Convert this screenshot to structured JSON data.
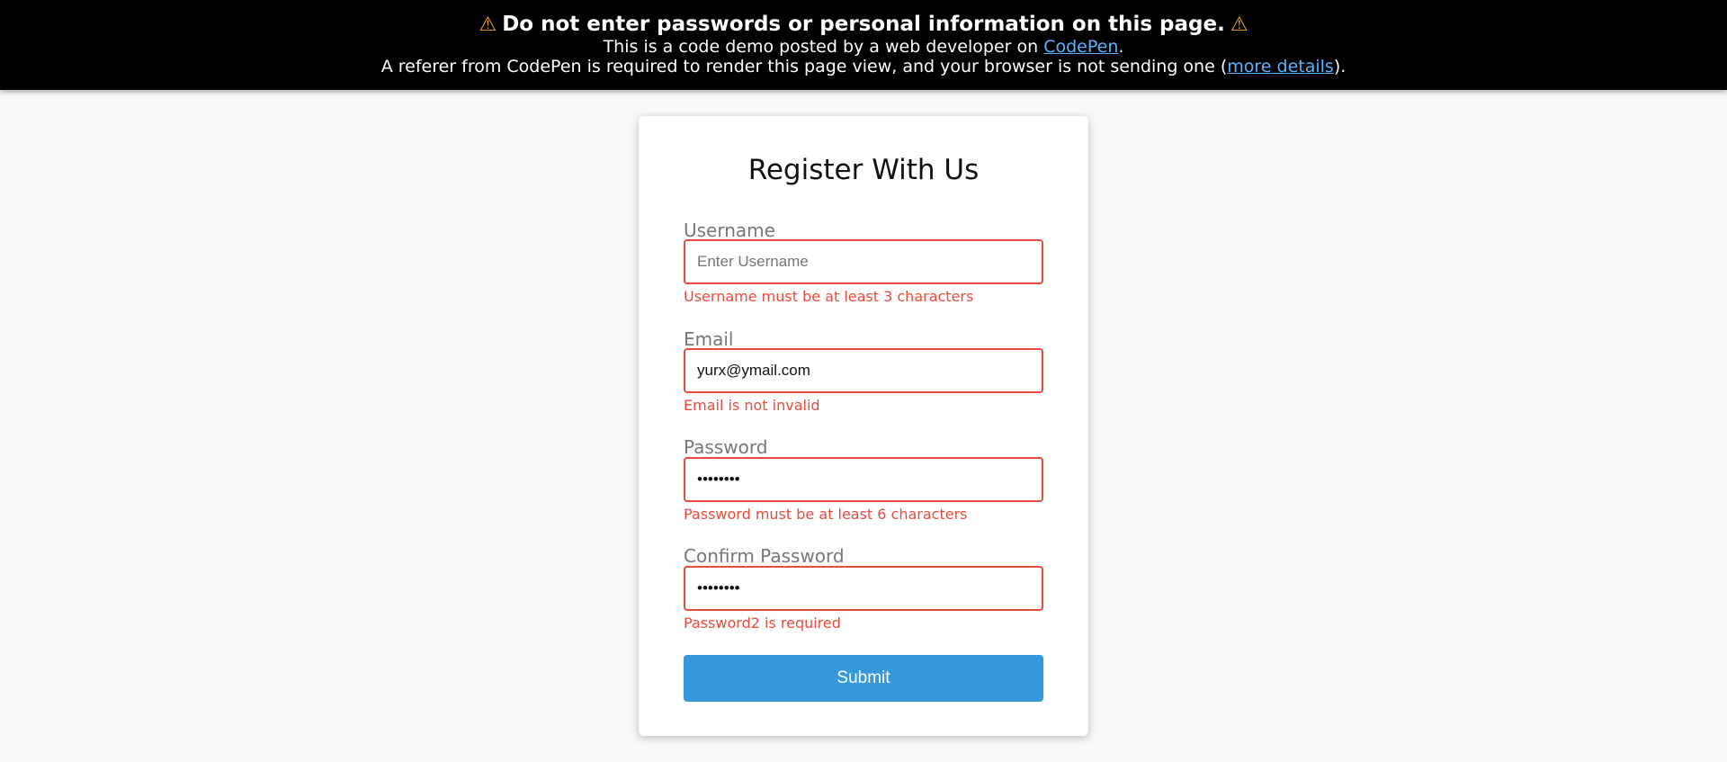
{
  "banner": {
    "headline": "Do not enter passwords or personal information on this page.",
    "warning_icon": "warning-triangle-icon",
    "line2_prefix": "This is a code demo posted by a web developer on ",
    "line2_link": "CodePen",
    "line2_suffix": ".",
    "line3_prefix": "A referer from CodePen is required to render this page view, and your browser is not sending one (",
    "line3_link": "more details",
    "line3_suffix": ")."
  },
  "form": {
    "title": "Register With Us",
    "fields": [
      {
        "label": "Username",
        "type": "text",
        "value": "",
        "placeholder": "Enter Username",
        "error": "Username must be at least 3 characters"
      },
      {
        "label": "Email",
        "type": "text",
        "value": "yurx@ymail.com",
        "placeholder": "",
        "error": "Email is not invalid"
      },
      {
        "label": "Password",
        "type": "password",
        "value": "12345678",
        "placeholder": "",
        "error": "Password must be at least 6 characters"
      },
      {
        "label": "Confirm Password",
        "type": "password",
        "value": "12345678",
        "placeholder": "",
        "error": "Password2 is required"
      }
    ],
    "submit_label": "Submit"
  },
  "colors": {
    "error": "#e74c3c",
    "accent": "#3498db",
    "banner_bg": "#000000",
    "link": "#58b4ff",
    "warning": "#f6a623"
  }
}
